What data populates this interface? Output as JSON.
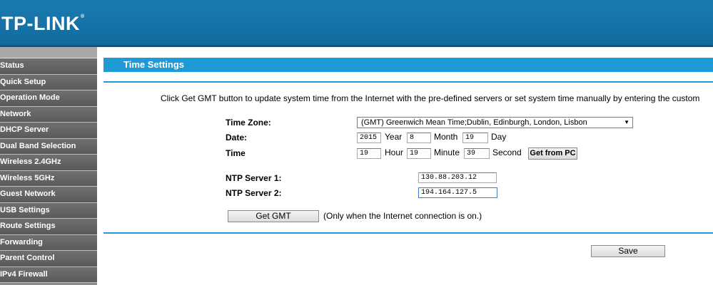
{
  "header": {
    "logo": "TP-LINK",
    "logo_mark": "®"
  },
  "sidebar": {
    "items": [
      {
        "label": "Status"
      },
      {
        "label": "Quick Setup"
      },
      {
        "label": "Operation Mode"
      },
      {
        "label": "Network"
      },
      {
        "label": "DHCP Server"
      },
      {
        "label": "Dual Band Selection"
      },
      {
        "label": "Wireless 2.4GHz"
      },
      {
        "label": "Wireless 5GHz"
      },
      {
        "label": "Guest Network"
      },
      {
        "label": "USB Settings"
      },
      {
        "label": "Route Settings"
      },
      {
        "label": "Forwarding"
      },
      {
        "label": "Parent Control"
      },
      {
        "label": "IPv4 Firewall"
      }
    ]
  },
  "main": {
    "title": "Time Settings",
    "intro": "Click Get GMT button to update system time from the Internet with the pre-defined servers or set system time manually by entering the custom",
    "time_zone": {
      "label": "Time Zone:",
      "value": "(GMT) Greenwich Mean Time;Dublin, Edinburgh, London, Lisbon"
    },
    "date": {
      "label": "Date:",
      "year": "2015",
      "year_label": "Year",
      "month": "8",
      "month_label": "Month",
      "day": "19",
      "day_label": "Day"
    },
    "time": {
      "label": "Time",
      "hour": "19",
      "hour_label": "Hour",
      "minute": "19",
      "minute_label": "Minute",
      "second": "39",
      "second_label": "Second",
      "get_from_pc": "Get from PC"
    },
    "ntp1": {
      "label": "NTP Server 1:",
      "value": "130.88.203.12"
    },
    "ntp2": {
      "label": "NTP Server 2:",
      "value": "194.164.127.5"
    },
    "get_gmt": "Get GMT",
    "get_gmt_note": "(Only when the Internet connection is on.)",
    "save": "Save"
  }
}
